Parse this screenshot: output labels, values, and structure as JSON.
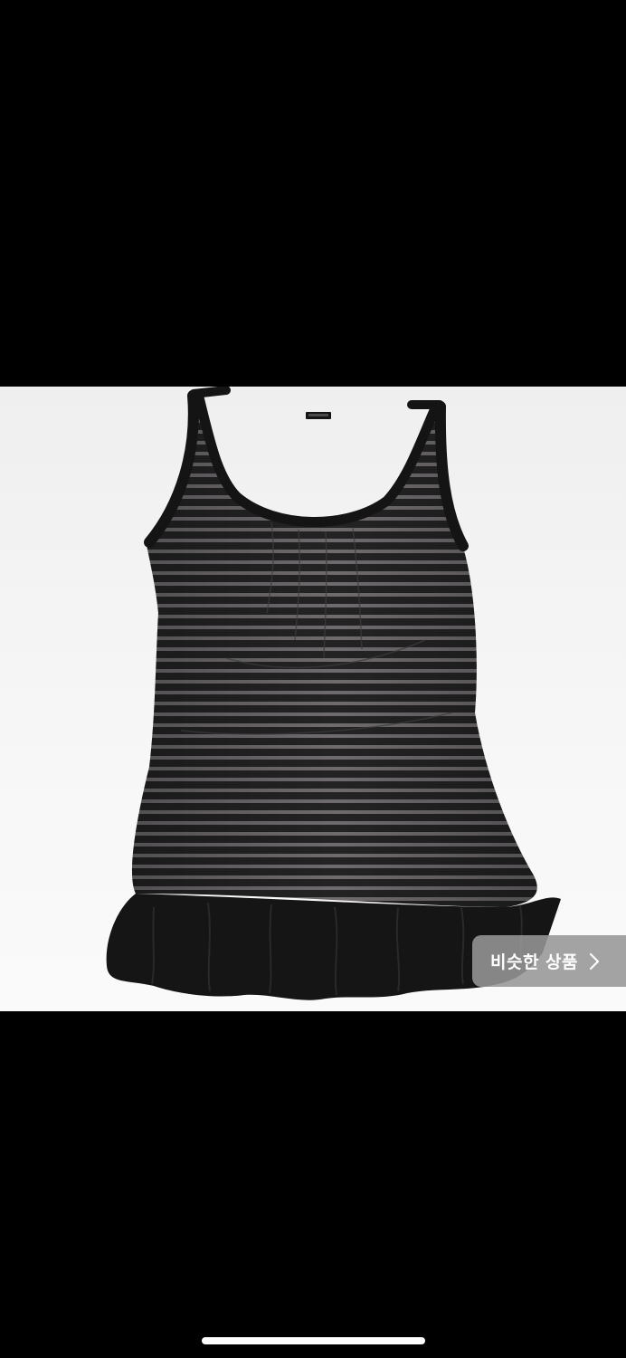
{
  "viewer": {
    "background": "#000000",
    "image_background": "#f4f4f4"
  },
  "product_image": {
    "subject": "dress",
    "stripe_dark": "#232323",
    "stripe_light": "#6e6a6e",
    "ruffle_color": "#151515"
  },
  "similar_products": {
    "label": "비슷한 상품",
    "icon": "chevron-right-icon"
  },
  "home_indicator": {
    "color": "#ffffff"
  }
}
